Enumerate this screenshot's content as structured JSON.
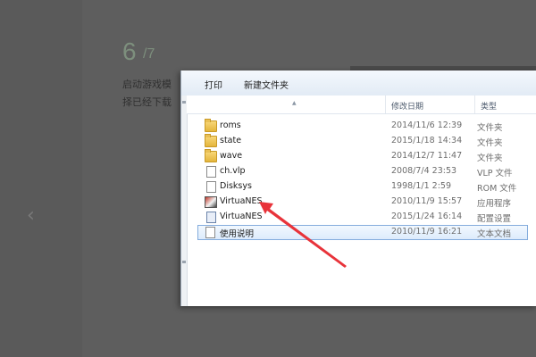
{
  "background": {
    "step_number": "6",
    "step_total": "/7",
    "text_line1": "启动游戏模",
    "text_line2": "择已经下载"
  },
  "toolbar": {
    "print_label": "打印",
    "new_folder_label": "新建文件夹"
  },
  "columns": {
    "name": "",
    "date": "修改日期",
    "type": "类型"
  },
  "files": [
    {
      "name": "roms",
      "date": "2014/11/6 12:39",
      "type": "文件夹",
      "icon": "folder-icon"
    },
    {
      "name": "state",
      "date": "2015/1/18 14:34",
      "type": "文件夹",
      "icon": "folder-icon"
    },
    {
      "name": "wave",
      "date": "2014/12/7 11:47",
      "type": "文件夹",
      "icon": "folder-icon"
    },
    {
      "name": "ch.vlp",
      "date": "2008/7/4 23:53",
      "type": "VLP 文件",
      "icon": "file-icon"
    },
    {
      "name": "Disksys",
      "date": "1998/1/1 2:59",
      "type": "ROM 文件",
      "icon": "file-icon"
    },
    {
      "name": "VirtuaNES",
      "date": "2010/11/9 15:57",
      "type": "应用程序",
      "icon": "app-icon"
    },
    {
      "name": "VirtuaNES",
      "date": "2015/1/24 16:14",
      "type": "配置设置",
      "icon": "config-file-icon"
    },
    {
      "name": "使用说明",
      "date": "2010/11/9 16:21",
      "type": "文本文档",
      "icon": "text-file-icon",
      "selected": true
    }
  ],
  "colors": {
    "annotation_arrow": "#e8333a",
    "selection_border": "#84acdd",
    "folder": "#e4b53c"
  }
}
